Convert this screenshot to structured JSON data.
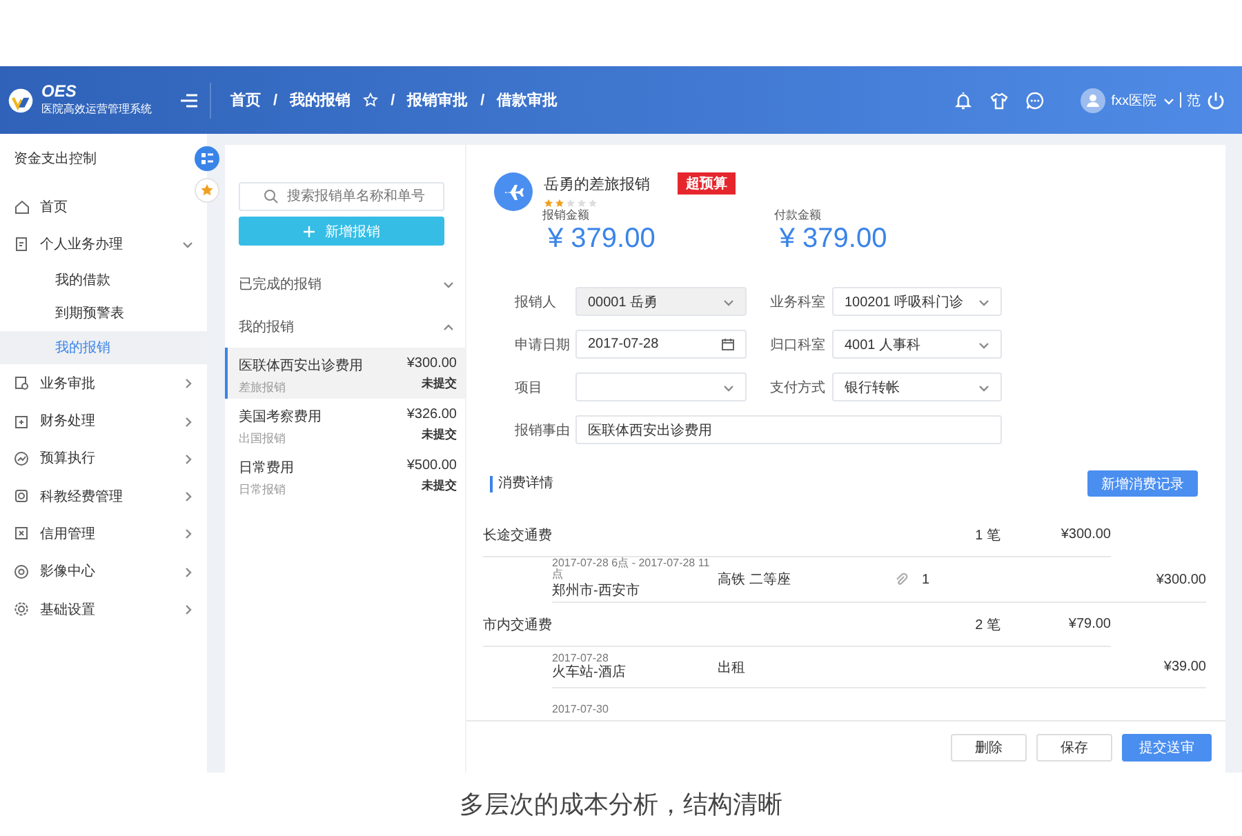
{
  "header": {
    "logo_title": "OES",
    "logo_subtitle": "医院高效运营管理系统",
    "breadcrumbs": [
      {
        "label": "首页",
        "starred": false
      },
      {
        "label": "我的报销",
        "starred": true
      },
      {
        "label": "报销审批",
        "starred": false
      },
      {
        "label": "借款审批",
        "starred": false
      }
    ],
    "breadcrumb_separator": "/",
    "user": "fxx医院",
    "user_extra": "范"
  },
  "sidebar": {
    "title": "资金支出控制",
    "items": [
      {
        "label": "首页",
        "kind": "link"
      },
      {
        "label": "个人业务办理",
        "kind": "group",
        "expanded": true,
        "children": [
          {
            "label": "我的借款",
            "selected": false
          },
          {
            "label": "到期预警表",
            "selected": false
          },
          {
            "label": "我的报销",
            "selected": true
          }
        ]
      },
      {
        "label": "业务审批",
        "kind": "group",
        "expanded": false
      },
      {
        "label": "财务处理",
        "kind": "group",
        "expanded": false
      },
      {
        "label": "预算执行",
        "kind": "group",
        "expanded": false
      },
      {
        "label": "科教经费管理",
        "kind": "group",
        "expanded": false
      },
      {
        "label": "信用管理",
        "kind": "group",
        "expanded": false
      },
      {
        "label": "影像中心",
        "kind": "group",
        "expanded": false
      },
      {
        "label": "基础设置",
        "kind": "group",
        "expanded": false
      }
    ]
  },
  "list_panel": {
    "search": {
      "placeholder": "搜索报销单名称和单号"
    },
    "new_button": "新增报销",
    "sections": [
      {
        "title": "已完成的报销",
        "expanded": false
      },
      {
        "title": "我的报销",
        "expanded": true,
        "items": [
          {
            "title": "医联体西安出诊费用",
            "type": "差旅报销",
            "amount": "¥300.00",
            "status": "未提交",
            "selected": true
          },
          {
            "title": "美国考察费用",
            "type": "出国报销",
            "amount": "¥326.00",
            "status": "未提交",
            "selected": false
          },
          {
            "title": "日常费用",
            "type": "日常报销",
            "amount": "¥500.00",
            "status": "未提交",
            "selected": false
          }
        ]
      }
    ]
  },
  "detail": {
    "title": "岳勇的差旅报销",
    "badge": "超预算",
    "stars": 2,
    "amounts": [
      {
        "label": "报销金额",
        "value": "¥ 379.00"
      },
      {
        "label": "付款金额",
        "value": "¥ 379.00"
      }
    ],
    "fields": [
      {
        "label": "报销人",
        "value": "00001 岳勇",
        "kind": "select",
        "disabled": true
      },
      {
        "label": "业务科室",
        "value": "100201 呼吸科门诊",
        "kind": "select",
        "disabled": false
      },
      {
        "label": "申请日期",
        "value": "2017-07-28",
        "kind": "date",
        "disabled": false
      },
      {
        "label": "归口科室",
        "value": "4001 人事科",
        "kind": "select",
        "disabled": false
      },
      {
        "label": "项目",
        "kind": "select",
        "disabled": false
      },
      {
        "label": "支付方式",
        "value": "银行转帐",
        "kind": "select",
        "disabled": false
      },
      {
        "label": "报销事由",
        "value": "医联体西安出诊费用",
        "kind": "text",
        "disabled": false
      }
    ],
    "expenses": {
      "heading": "消费详情",
      "add_button": "新增消费记录",
      "groups": [
        {
          "name": "长途交通费",
          "count": "1 笔",
          "total": "¥300.00",
          "records": [
            {
              "time": "2017-07-28 6点 - 2017-07-28 11 点",
              "route": "郑州市-西安市",
              "mode": "高铁 二等座",
              "attachments": "1",
              "amount": "¥300.00"
            }
          ]
        },
        {
          "name": "市内交通费",
          "count": "2 笔",
          "total": "¥79.00",
          "records": [
            {
              "time": "2017-07-28",
              "route": "火车站-酒店",
              "mode": "出租",
              "amount": "¥39.00"
            },
            {
              "time": "2017-07-30"
            }
          ]
        }
      ]
    },
    "buttons": [
      {
        "label": "删除",
        "kind": "default"
      },
      {
        "label": "保存",
        "kind": "default"
      },
      {
        "label": "提交送审",
        "kind": "primary"
      }
    ]
  },
  "caption": "多层次的成本分析，结构清晰"
}
